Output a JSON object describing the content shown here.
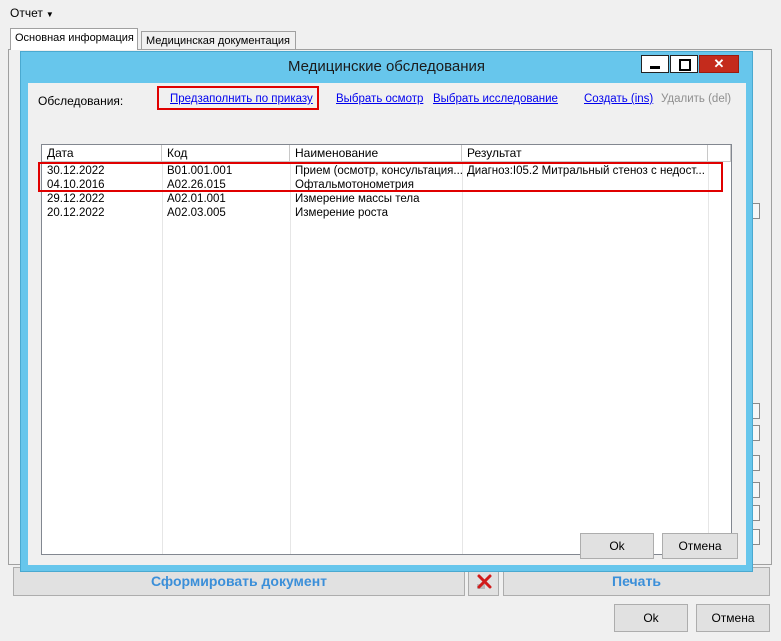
{
  "menu": {
    "label": "Отчет"
  },
  "tabs": [
    {
      "label": "Основная информация",
      "active": true
    },
    {
      "label": "Медицинская документация",
      "active": false
    }
  ],
  "bottom": {
    "generate_label": "Сформировать документ",
    "print_label": "Печать",
    "ok_label": "Ok",
    "cancel_label": "Отмена"
  },
  "dialog": {
    "title": "Медицинские обследования",
    "exams_label": "Обследования:",
    "links": {
      "prefill": "Предзаполнить по приказу",
      "select_exam": "Выбрать осмотр",
      "select_study": "Выбрать исследование",
      "create": "Создать (ins)",
      "delete": "Удалить (del)"
    },
    "columns": [
      "Дата",
      "Код",
      "Наименование",
      "Результат"
    ],
    "rows": [
      {
        "date": "30.12.2022",
        "code": "B01.001.001",
        "name": "Прием (осмотр, консультация...",
        "result": "Диагноз:I05.2 Митральный стеноз с недост..."
      },
      {
        "date": "04.10.2016",
        "code": "A02.26.015",
        "name": "Офтальмотонометрия",
        "result": ""
      },
      {
        "date": "29.12.2022",
        "code": "A02.01.001",
        "name": "Измерение массы тела",
        "result": ""
      },
      {
        "date": "20.12.2022",
        "code": "A02.03.005",
        "name": "Измерение роста",
        "result": ""
      }
    ],
    "ok_label": "Ok",
    "cancel_label": "Отмена"
  },
  "colors": {
    "dialog_frame": "#67c6ec",
    "highlight": "#e00000",
    "link": "#0000ee",
    "accent_text": "#3b8fd9"
  }
}
